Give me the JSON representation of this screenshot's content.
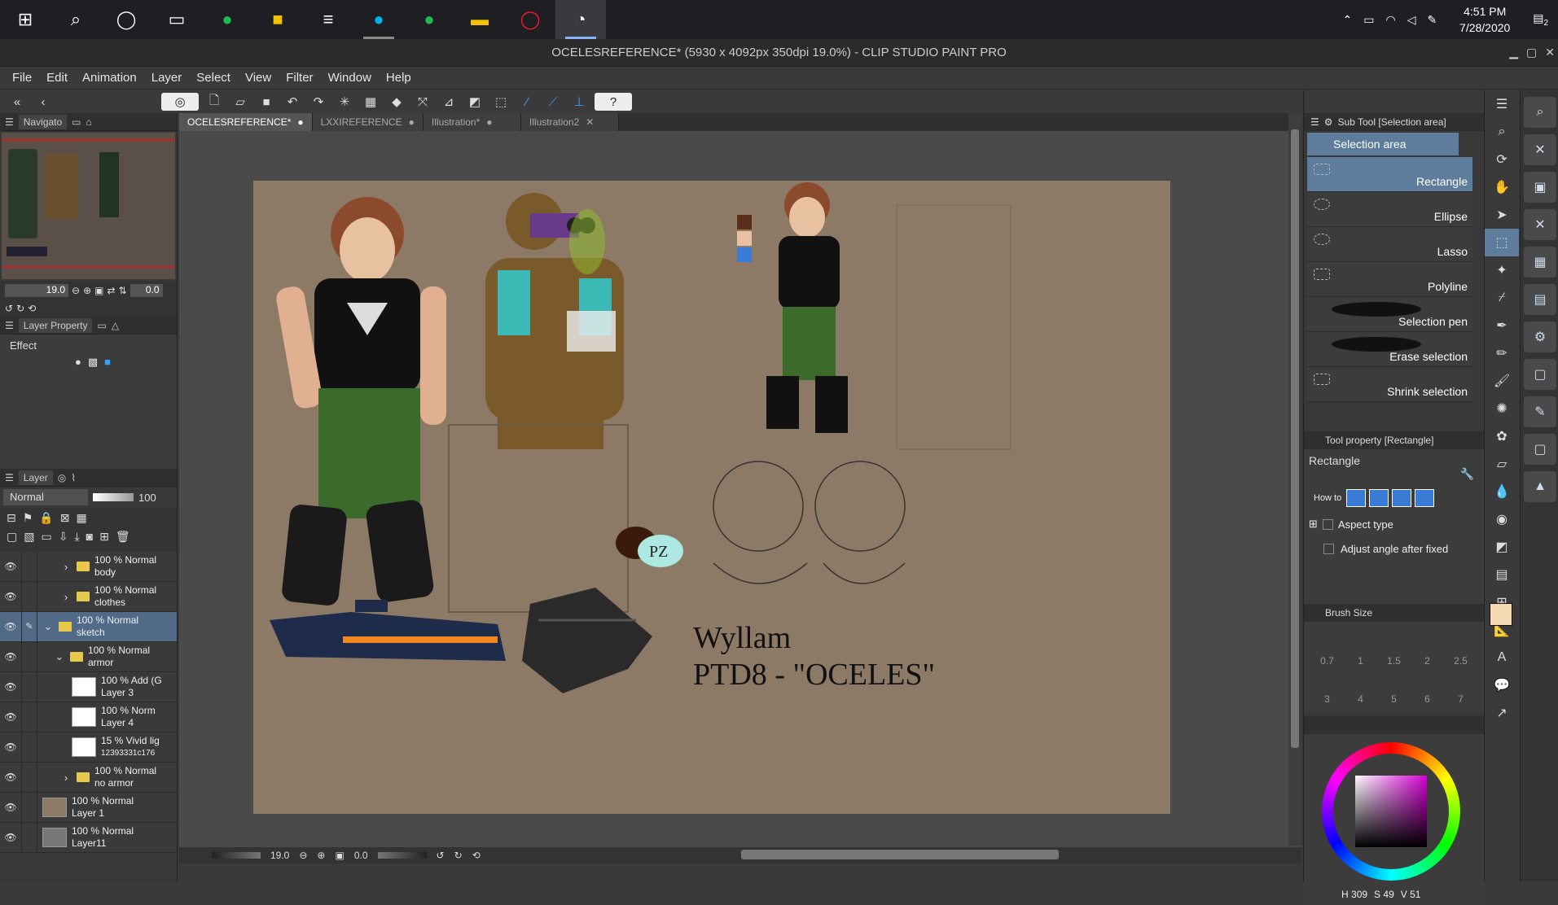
{
  "taskbar": {
    "clock_time": "4:51 PM",
    "clock_date": "7/28/2020",
    "notification_count": "2"
  },
  "window": {
    "title": "OCELESREFERENCE* (5930 x 4092px 350dpi 19.0%)  - CLIP STUDIO PAINT PRO"
  },
  "menu": [
    "File",
    "Edit",
    "Animation",
    "Layer",
    "Select",
    "View",
    "Filter",
    "Window",
    "Help"
  ],
  "navigator": {
    "tab_label": "Navigato",
    "zoom": "19.0",
    "rotation": "0.0"
  },
  "layer_property": {
    "tab_label": "Layer Property",
    "effect_label": "Effect"
  },
  "layers_panel": {
    "tab_label": "Layer",
    "blend_mode": "Normal",
    "opacity": "100",
    "layers": [
      {
        "line1": "100 % Normal",
        "line2": "body",
        "type": "folder",
        "indent": 1,
        "expanded": false,
        "selected": false
      },
      {
        "line1": "100 % Normal",
        "line2": "clothes",
        "type": "folder",
        "indent": 1,
        "expanded": false,
        "selected": false
      },
      {
        "line1": "100 % Normal",
        "line2": "sketch",
        "type": "folder",
        "indent": 0,
        "expanded": true,
        "selected": true
      },
      {
        "line1": "100 % Normal",
        "line2": "armor",
        "type": "folder",
        "indent": 1,
        "expanded": true,
        "selected": false
      },
      {
        "line1": "100 % Add (G",
        "line2": "Layer 3",
        "type": "raster",
        "indent": 2,
        "selected": false
      },
      {
        "line1": "100 % Norm",
        "line2": "Layer 4",
        "type": "raster",
        "indent": 2,
        "selected": false
      },
      {
        "line1": "15 % Vivid lig",
        "line2": "12393331c176",
        "type": "raster",
        "indent": 2,
        "selected": false
      },
      {
        "line1": "100 % Normal",
        "line2": "no armor",
        "type": "folder",
        "indent": 1,
        "expanded": false,
        "selected": false
      },
      {
        "line1": "100 % Normal",
        "line2": "Layer 1",
        "type": "raster-tan",
        "indent": 0,
        "selected": false
      },
      {
        "line1": "100 % Normal",
        "line2": "Layer11",
        "type": "raster-gray",
        "indent": 0,
        "selected": false
      }
    ]
  },
  "document_tabs": [
    {
      "label": "OCELESREFERENCE*",
      "active": true
    },
    {
      "label": "LXXIREFERENCE",
      "active": false
    },
    {
      "label": "Illustration*",
      "active": false
    },
    {
      "label": "Illustration2",
      "active": false
    }
  ],
  "artwork": {
    "caption_name": "Wyllam",
    "caption_title": "PTD8 - \"OCELES\"",
    "bubble_text": "PZ"
  },
  "canvas_status": {
    "zoom": "19.0",
    "rotation": "0.0"
  },
  "sub_tool": {
    "header": "Sub Tool [Selection area]",
    "group_label": "Selection area",
    "items": [
      {
        "label": "Rectangle",
        "selected": true
      },
      {
        "label": "Ellipse",
        "selected": false
      },
      {
        "label": "Lasso",
        "selected": false
      },
      {
        "label": "Polyline",
        "selected": false
      },
      {
        "label": "Selection pen",
        "selected": false
      },
      {
        "label": "Erase selection",
        "selected": false
      },
      {
        "label": "Shrink selection",
        "selected": false
      }
    ]
  },
  "tool_property": {
    "header": "Tool property [Rectangle]",
    "tool_name": "Rectangle",
    "how_to_label": "How to",
    "aspect_type_label": "Aspect type",
    "adjust_angle_label": "Adjust angle after fixed"
  },
  "brush_size": {
    "header": "Brush Size",
    "sizes": [
      "0.7",
      "1",
      "1.5",
      "2",
      "2.5",
      "3",
      "4",
      "5",
      "6",
      "7"
    ]
  },
  "color": {
    "h_label": "H",
    "h": "309",
    "s_label": "S",
    "s": "49",
    "v_label": "V",
    "v": "51",
    "main_color": "#f2d9b3",
    "sub_color": "#8a3a7a"
  }
}
